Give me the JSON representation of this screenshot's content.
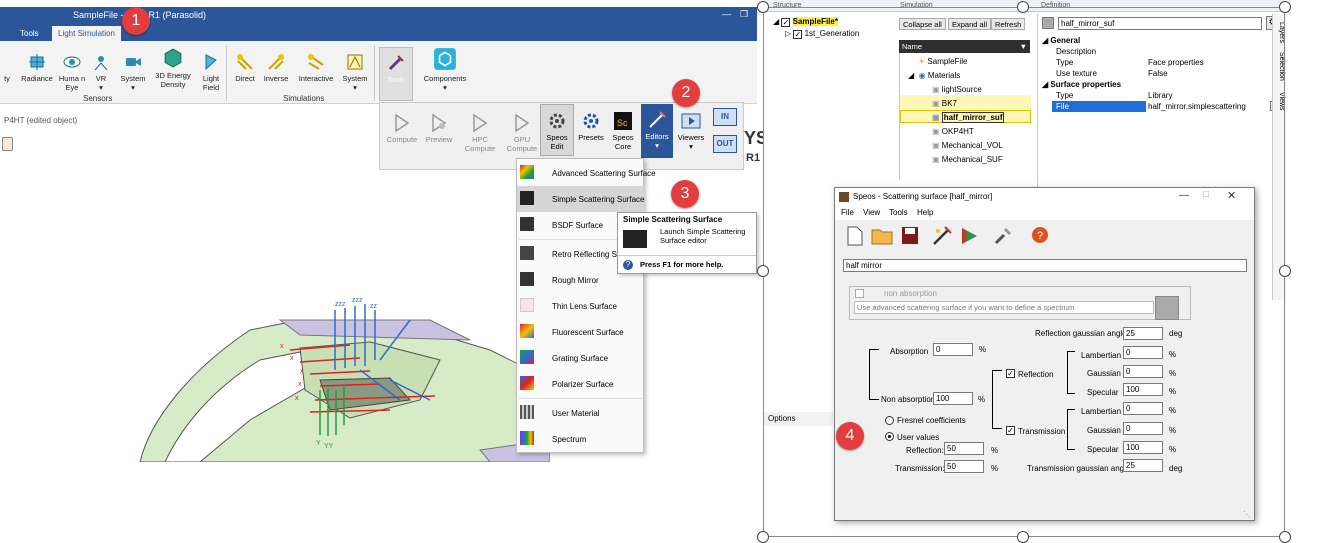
{
  "app": {
    "title": "SampleFile - 2023 R1 (Parasolid)",
    "tabs": [
      "Tools",
      "Light Simulation"
    ],
    "sensors_group": {
      "label": "Sensors",
      "items": [
        "ty",
        "Radiance",
        "Huma n Eye",
        "VR",
        "System",
        "3D Energy Density",
        "Light Field"
      ]
    },
    "simulations_group": {
      "label": "Simulations",
      "items": [
        "Direct",
        "Inverse",
        "Interactive",
        "System"
      ]
    },
    "tools_label": "Tools",
    "components_label": "Components",
    "edited_object": "P4HT (edited object)",
    "sim_buttons": [
      "Compute",
      "Preview",
      "HPC Compute",
      "GPU Compute",
      "Speos Edit",
      "Presets",
      "Speos Core",
      "Editors",
      "Viewers"
    ],
    "io": [
      "IN",
      "OUT"
    ],
    "brand_partial": "YS",
    "brand_partial2": "R1"
  },
  "editors_menu": {
    "items": [
      "Advanced Scattering Surface",
      "Simple Scattering Surface",
      "BSDF Surface",
      "Retro Reflecting Su",
      "Rough Mirror",
      "Thin Lens Surface",
      "Fluorescent Surface",
      "Grating Surface",
      "Polarizer Surface",
      "User Material",
      "Spectrum"
    ],
    "tooltip": {
      "title": "Simple Scattering Surface",
      "desc": "Launch Simple Scattering Surface editor",
      "help": "Press F1 for more help."
    }
  },
  "badges": [
    "1",
    "2",
    "3",
    "4"
  ],
  "structure": {
    "headers": [
      "Structure",
      "Simulation",
      "Definition"
    ],
    "tree": [
      "SampleFile*",
      "1st_Generation"
    ],
    "buttons": [
      "Collapse all",
      "Expand all",
      "Refresh"
    ],
    "list_header": "Name",
    "materials_tree": [
      "SampleFile",
      "Materials",
      "lightSource",
      "BK7",
      "half_mirror_suf",
      "OKP4HT",
      "Mechanical_VOL",
      "Mechanical_SUF"
    ],
    "definition_name": "half_mirror_suf",
    "side_tabs": [
      "Layers",
      "Selection",
      "Views"
    ],
    "options_label": "Options",
    "properties": [
      {
        "section": "General"
      },
      {
        "key": "Description",
        "value": ""
      },
      {
        "key": "Type",
        "value": "Face properties"
      },
      {
        "key": "Use texture",
        "value": "False"
      },
      {
        "section": "Surface properties"
      },
      {
        "key": "Type",
        "value": "Library"
      },
      {
        "key": "File",
        "value": "half_mirror.simplescattering"
      }
    ]
  },
  "dialog": {
    "title": "Speos - Scattering surface [half_mirror]",
    "menu": [
      "File",
      "View",
      "Tools",
      "Help"
    ],
    "name_value": "half mirror",
    "non_absorption_check": "non absorption",
    "hint": "Use advanced scattering surface if you want to define a spectrum",
    "reflection_gaussian_angle_label": "Reflection gaussian angle",
    "reflection_gaussian_angle": "25",
    "transmission_gaussian_angle_label": "Transmission gaussian angle",
    "transmission_gaussian_angle": "25",
    "deg": "deg",
    "absorption_label": "Absorption",
    "absorption": "0",
    "non_absorption_label": "Non absorption",
    "non_absorption": "100",
    "pct": "%",
    "reflection_check": "Reflection",
    "transmission_check": "Transmission",
    "lambertian_label": "Lambertian",
    "gaussian_label": "Gaussian",
    "specular_label": "Specular",
    "refl": {
      "lambertian": "0",
      "gaussian": "0",
      "specular": "100"
    },
    "trans": {
      "lambertian": "0",
      "gaussian": "0",
      "specular": "100"
    },
    "fresnel": "Fresnel coefficients",
    "user_values": "User values",
    "reflection_label": "Reflection:",
    "reflection_value": "50",
    "transmission_label": "Transmission:",
    "transmission_value": "50"
  }
}
